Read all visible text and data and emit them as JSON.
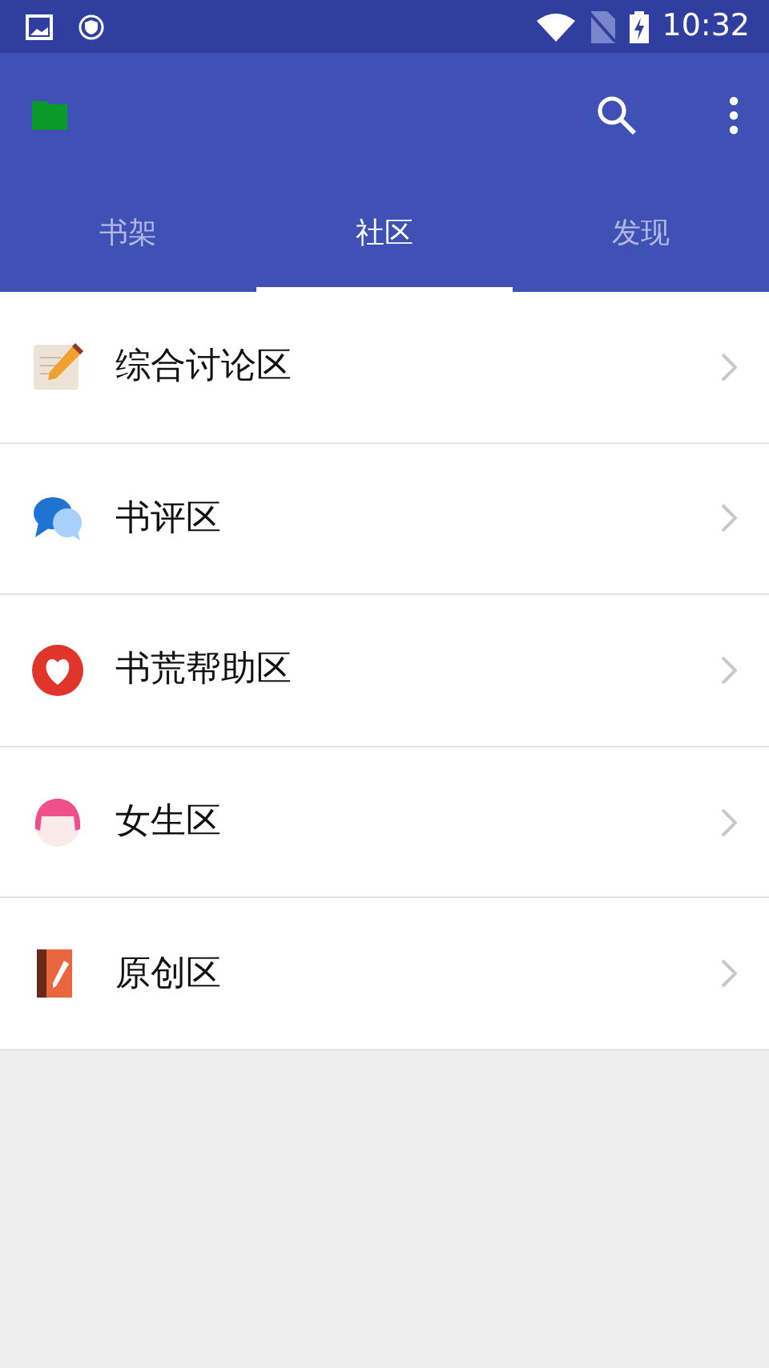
{
  "status_bar": {
    "time": "10:32"
  },
  "tabs": [
    {
      "label": "书架",
      "selected": false
    },
    {
      "label": "社区",
      "selected": true
    },
    {
      "label": "发现",
      "selected": false
    }
  ],
  "items": [
    {
      "kind": "notepad",
      "label": "综合讨论区"
    },
    {
      "kind": "chat",
      "label": "书评区"
    },
    {
      "kind": "heart",
      "label": "书荒帮助区"
    },
    {
      "kind": "girl",
      "label": "女生区"
    },
    {
      "kind": "book",
      "label": "原创区"
    }
  ]
}
